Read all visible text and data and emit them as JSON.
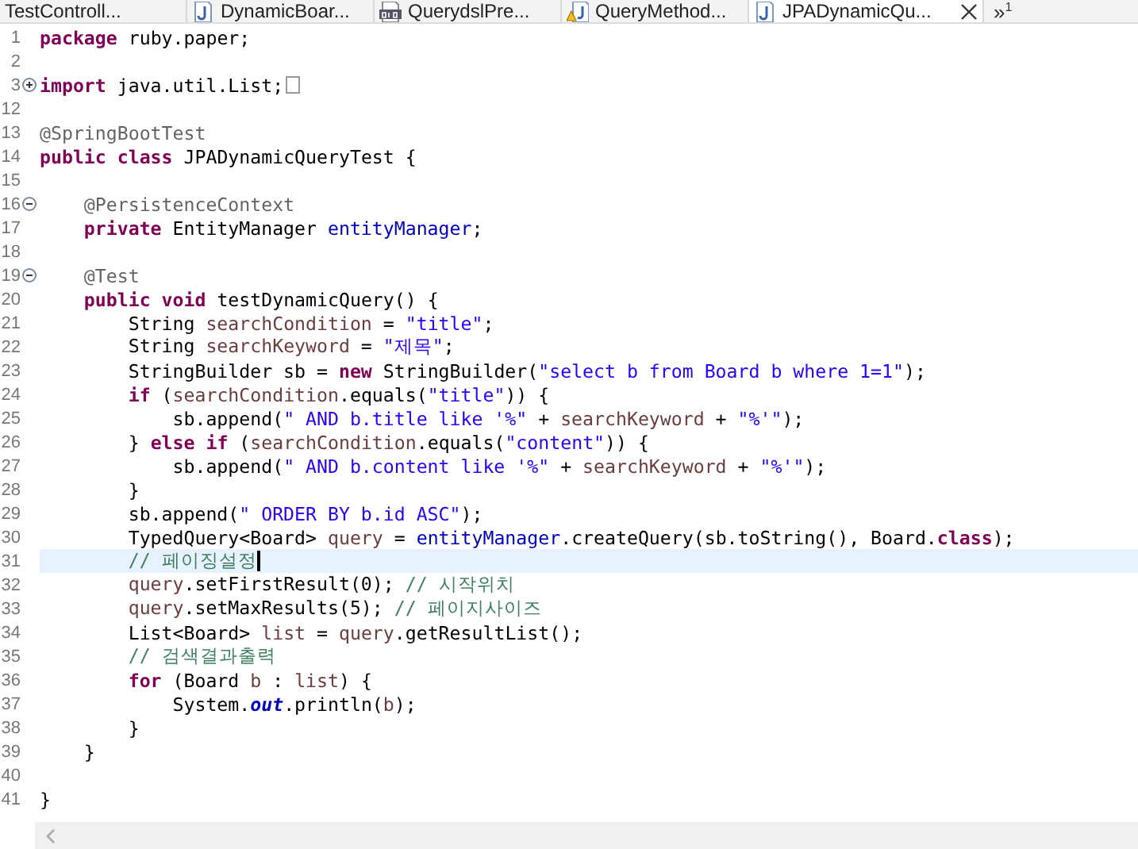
{
  "tabs": [
    {
      "label": "TestControll...",
      "kind": "none",
      "selected": false
    },
    {
      "label": "DynamicBoar...",
      "kind": "java",
      "selected": false
    },
    {
      "label": "QuerydslPre...",
      "kind": "class",
      "selected": false
    },
    {
      "label": "QueryMethod...",
      "kind": "java-warning",
      "selected": false
    },
    {
      "label": "JPADynamicQu...",
      "kind": "java",
      "selected": true
    }
  ],
  "overflow": {
    "symbol": "»",
    "count": "1"
  },
  "lines": [
    {
      "n": "1",
      "current": false,
      "tokens": [
        {
          "kind": "keyword",
          "text": "package"
        },
        {
          "kind": "plain",
          "text": " ruby.paper;"
        }
      ]
    },
    {
      "n": "2",
      "current": false
    },
    {
      "n": "3",
      "current": false,
      "expanded": false,
      "tokens": [
        {
          "kind": "keyword",
          "text": "import"
        },
        {
          "kind": "plain",
          "text": " java.util.List;"
        }
      ]
    },
    {
      "n": "12",
      "current": false
    },
    {
      "n": "13",
      "current": false,
      "tokens": [
        {
          "kind": "annotation",
          "text": "@SpringBootTest"
        }
      ]
    },
    {
      "n": "14",
      "current": false,
      "tokens": [
        {
          "kind": "keyword",
          "text": "public"
        },
        {
          "kind": "keyword",
          "text": " class"
        },
        {
          "kind": "plain",
          "text": " JPADynamicQueryTest {"
        }
      ]
    },
    {
      "n": "15",
      "current": false
    },
    {
      "n": "16",
      "current": false,
      "expanded": true,
      "tokens": [
        {
          "kind": "annotation",
          "text": "    @PersistenceContext"
        }
      ]
    },
    {
      "n": "17",
      "current": false,
      "tokens": [
        {
          "kind": "keyword",
          "text": "    private"
        },
        {
          "kind": "plain",
          "text": " EntityManager "
        },
        {
          "kind": "field",
          "text": "entityManager"
        },
        {
          "kind": "plain",
          "text": ";"
        }
      ]
    },
    {
      "n": "18",
      "current": false
    },
    {
      "n": "19",
      "current": false,
      "expanded": true,
      "tokens": [
        {
          "kind": "annotation",
          "text": "    @Test"
        }
      ]
    },
    {
      "n": "20",
      "current": false,
      "tokens": [
        {
          "kind": "keyword",
          "text": "    public"
        },
        {
          "kind": "keyword",
          "text": " void"
        },
        {
          "kind": "plain",
          "text": " testDynamicQuery() {"
        }
      ]
    },
    {
      "n": "21",
      "current": false,
      "tokens": [
        {
          "kind": "plain",
          "text": "        String "
        },
        {
          "kind": "local",
          "text": "searchCondition"
        },
        {
          "kind": "plain",
          "text": " = "
        },
        {
          "kind": "string",
          "text": "\"title\""
        },
        {
          "kind": "plain",
          "text": ";"
        }
      ]
    },
    {
      "n": "22",
      "current": false,
      "tokens": [
        {
          "kind": "plain",
          "text": "        String "
        },
        {
          "kind": "local",
          "text": "searchKeyword"
        },
        {
          "kind": "plain",
          "text": " = "
        },
        {
          "kind": "string",
          "text": "\"제목\""
        },
        {
          "kind": "plain",
          "text": ";"
        }
      ]
    },
    {
      "n": "23",
      "current": false,
      "tokens": [
        {
          "kind": "plain",
          "text": "        StringBuilder sb = "
        },
        {
          "kind": "keyword",
          "text": "new"
        },
        {
          "kind": "plain",
          "text": " StringBuilder("
        },
        {
          "kind": "string",
          "text": "\"select b from Board b where 1=1\""
        },
        {
          "kind": "plain",
          "text": ");"
        }
      ]
    },
    {
      "n": "24",
      "current": false,
      "tokens": [
        {
          "kind": "keyword",
          "text": "        if"
        },
        {
          "kind": "plain",
          "text": " ("
        },
        {
          "kind": "local",
          "text": "searchCondition"
        },
        {
          "kind": "plain",
          "text": ".equals("
        },
        {
          "kind": "string",
          "text": "\"title\""
        },
        {
          "kind": "plain",
          "text": ")) {"
        }
      ]
    },
    {
      "n": "25",
      "current": false,
      "tokens": [
        {
          "kind": "plain",
          "text": "            sb.append("
        },
        {
          "kind": "string",
          "text": "\" AND b.title like '%\""
        },
        {
          "kind": "plain",
          "text": " + "
        },
        {
          "kind": "local",
          "text": "searchKeyword"
        },
        {
          "kind": "plain",
          "text": " + "
        },
        {
          "kind": "string",
          "text": "\"%'\""
        },
        {
          "kind": "plain",
          "text": ");"
        }
      ]
    },
    {
      "n": "26",
      "current": false,
      "tokens": [
        {
          "kind": "plain",
          "text": "        } "
        },
        {
          "kind": "keyword",
          "text": "else"
        },
        {
          "kind": "keyword",
          "text": " if"
        },
        {
          "kind": "plain",
          "text": " ("
        },
        {
          "kind": "local",
          "text": "searchCondition"
        },
        {
          "kind": "plain",
          "text": ".equals("
        },
        {
          "kind": "string",
          "text": "\"content\""
        },
        {
          "kind": "plain",
          "text": ")) {"
        }
      ]
    },
    {
      "n": "27",
      "current": false,
      "tokens": [
        {
          "kind": "plain",
          "text": "            sb.append("
        },
        {
          "kind": "string",
          "text": "\" AND b.content like '%\""
        },
        {
          "kind": "plain",
          "text": " + "
        },
        {
          "kind": "local",
          "text": "searchKeyword"
        },
        {
          "kind": "plain",
          "text": " + "
        },
        {
          "kind": "string",
          "text": "\"%'\""
        },
        {
          "kind": "plain",
          "text": ");"
        }
      ]
    },
    {
      "n": "28",
      "current": false,
      "tokens": [
        {
          "kind": "plain",
          "text": "        }"
        }
      ]
    },
    {
      "n": "29",
      "current": false,
      "tokens": [
        {
          "kind": "plain",
          "text": "        sb.append("
        },
        {
          "kind": "string",
          "text": "\" ORDER BY b.id ASC\""
        },
        {
          "kind": "plain",
          "text": ");"
        }
      ]
    },
    {
      "n": "30",
      "current": false,
      "tokens": [
        {
          "kind": "plain",
          "text": "        TypedQuery<Board> "
        },
        {
          "kind": "local",
          "text": "query"
        },
        {
          "kind": "plain",
          "text": " = "
        },
        {
          "kind": "field",
          "text": "entityManager"
        },
        {
          "kind": "plain",
          "text": ".createQuery(sb.toString(), Board."
        },
        {
          "kind": "keyword",
          "text": "class"
        },
        {
          "kind": "plain",
          "text": ");"
        }
      ]
    },
    {
      "n": "31",
      "current": true,
      "tokens": [
        {
          "kind": "comment",
          "text": "        // 페이징설정"
        }
      ]
    },
    {
      "n": "32",
      "current": false,
      "tokens": [
        {
          "kind": "local",
          "text": "        query"
        },
        {
          "kind": "plain",
          "text": ".setFirstResult(0); "
        },
        {
          "kind": "comment",
          "text": "// 시작위치"
        }
      ]
    },
    {
      "n": "33",
      "current": false,
      "tokens": [
        {
          "kind": "local",
          "text": "        query"
        },
        {
          "kind": "plain",
          "text": ".setMaxResults(5); "
        },
        {
          "kind": "comment",
          "text": "// 페이지사이즈"
        }
      ]
    },
    {
      "n": "34",
      "current": false,
      "tokens": [
        {
          "kind": "plain",
          "text": "        List<Board> "
        },
        {
          "kind": "local",
          "text": "list"
        },
        {
          "kind": "plain",
          "text": " = "
        },
        {
          "kind": "local",
          "text": "query"
        },
        {
          "kind": "plain",
          "text": ".getResultList();"
        }
      ]
    },
    {
      "n": "35",
      "current": false,
      "tokens": [
        {
          "kind": "comment",
          "text": "        // 검색결과출력"
        }
      ]
    },
    {
      "n": "36",
      "current": false,
      "tokens": [
        {
          "kind": "keyword",
          "text": "        for"
        },
        {
          "kind": "plain",
          "text": " (Board "
        },
        {
          "kind": "local",
          "text": "b"
        },
        {
          "kind": "plain",
          "text": " : "
        },
        {
          "kind": "local",
          "text": "list"
        },
        {
          "kind": "plain",
          "text": ") {"
        }
      ]
    },
    {
      "n": "37",
      "current": false,
      "tokens": [
        {
          "kind": "plain",
          "text": "            System."
        },
        {
          "kind": "static",
          "text": "out"
        },
        {
          "kind": "plain",
          "text": ".println("
        },
        {
          "kind": "local",
          "text": "b"
        },
        {
          "kind": "plain",
          "text": ");"
        }
      ]
    },
    {
      "n": "38",
      "current": false,
      "tokens": [
        {
          "kind": "plain",
          "text": "        }"
        }
      ]
    },
    {
      "n": "39",
      "current": false,
      "tokens": [
        {
          "kind": "plain",
          "text": "    }"
        }
      ]
    },
    {
      "n": "40",
      "current": false
    },
    {
      "n": "41",
      "current": false,
      "tokens": [
        {
          "kind": "plain",
          "text": "}"
        }
      ]
    }
  ]
}
